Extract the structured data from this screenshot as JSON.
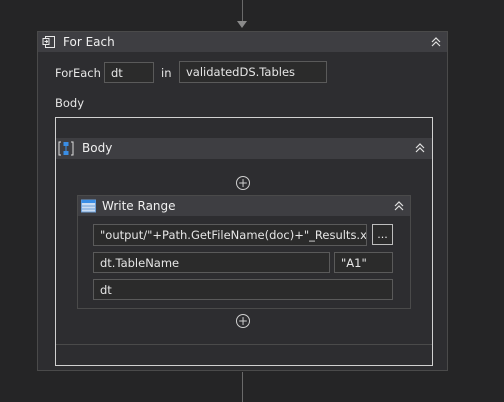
{
  "foreach": {
    "title": "For Each",
    "foreach_label": "ForEach",
    "item_variable": "dt",
    "in_label": "in",
    "collection": "validatedDS.Tables",
    "body_label": "Body"
  },
  "body_sequence": {
    "title": "Body"
  },
  "write_range": {
    "title": "Write Range",
    "workbook_path": "\"output/\"+Path.GetFileName(doc)+\"_Results.xlsx\"",
    "browse_label": "...",
    "sheet_name": "dt.TableName",
    "starting_cell": "\"A1\"",
    "data_table": "dt"
  },
  "icons": {
    "foreach": "foreach-icon",
    "body": "sequence-icon",
    "write_range": "table-icon",
    "collapse": "double-chevron-up-icon",
    "add": "plus-circle-icon"
  },
  "colors": {
    "background": "#252526",
    "panel": "#2d2d30",
    "header": "#3e3e42",
    "field": "#2b2b2b",
    "accent_blue": "#3a8ee6"
  }
}
